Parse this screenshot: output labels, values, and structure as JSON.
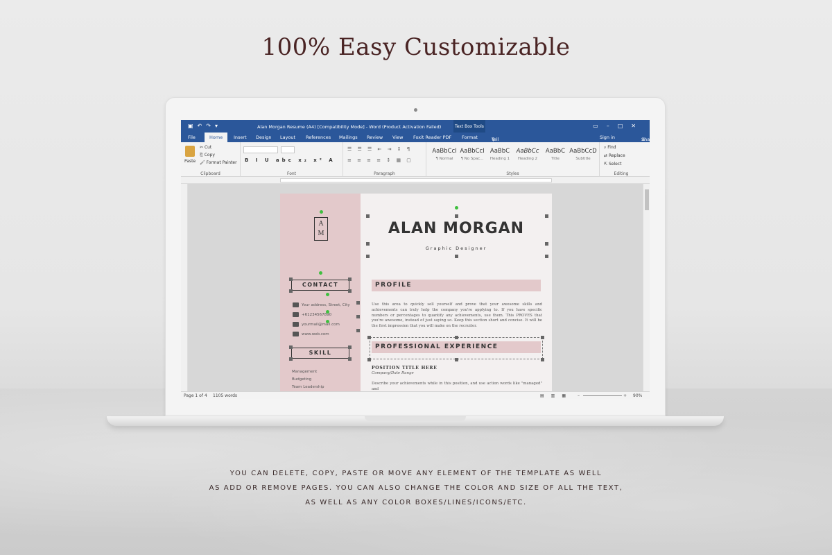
{
  "headline": "100% Easy Customizable",
  "caption": {
    "line1": "YOU CAN DELETE, COPY, PASTE OR MOVE ANY ELEMENT OF THE TEMPLATE AS WELL",
    "line2": "AS ADD OR REMOVE PAGES. YOU CAN ALSO CHANGE THE COLOR AND SIZE OF ALL THE TEXT,",
    "line3": "AS WELL AS ANY COLOR BOXES/LINES/ICONS/ETC."
  },
  "word": {
    "window_title": "Alan Morgan Resume (A4) [Compatibility Mode] - Word (Product Activation Failed)",
    "context_tab": "Text Box Tools",
    "tabs": [
      "File",
      "Home",
      "Insert",
      "Design",
      "Layout",
      "References",
      "Mailings",
      "Review",
      "View",
      "Foxit Reader PDF",
      "Format"
    ],
    "tell_me": "Tell me what you want to do...",
    "sign_in": "Sign in",
    "share": "Share",
    "clipboard": {
      "paste": "Paste",
      "cut": "Cut",
      "copy": "Copy",
      "format_painter": "Format Painter",
      "label": "Clipboard"
    },
    "font_label": "Font",
    "paragraph_label": "Paragraph",
    "styles": [
      {
        "preview": "AaBbCcI",
        "name": "¶ Normal"
      },
      {
        "preview": "AaBbCcI",
        "name": "¶ No Spac..."
      },
      {
        "preview": "AaBbC",
        "name": "Heading 1"
      },
      {
        "preview": "AaBbCc",
        "name": "Heading 2"
      },
      {
        "preview": "AaBbC",
        "name": "Title"
      },
      {
        "preview": "AaBbCcD",
        "name": "Subtitle"
      }
    ],
    "styles_label": "Styles",
    "editing": {
      "find": "Find",
      "replace": "Replace",
      "select": "Select",
      "label": "Editing"
    },
    "status": {
      "page": "Page 1 of 4",
      "words": "1105 words",
      "zoom": "90%"
    }
  },
  "resume": {
    "monogram_1": "A",
    "monogram_2": "M",
    "name": "ALAN MORGAN",
    "role": "Graphic Designer",
    "contact_heading": "CONTACT",
    "contact": [
      "Your address, Street, City",
      "+61234567890",
      "yourmail@mail.com",
      "www.web.com"
    ],
    "skill_heading": "SKILL",
    "skills": [
      "Management",
      "Budgeting",
      "Team Leadership"
    ],
    "profile_heading": "PROFILE",
    "profile_text": "Use this area to quickly sell yourself and prove that your awesome skills and achievements can truly help the company you're applying to. If you have specific numbers or percentages to quantify any achievements, use them. This PROVES that you're awesome, instead of just saying so. Keep this section short and concise. It will be the first impression that you will make on the recruiter.",
    "experience_heading": "PROFESSIONAL EXPERIENCE",
    "position_title": "POSITION TITLE HERE",
    "company_date": "Company/Date Range",
    "experience_text": "Describe your achievements while in this position, and use action words like \"managed\" and"
  }
}
